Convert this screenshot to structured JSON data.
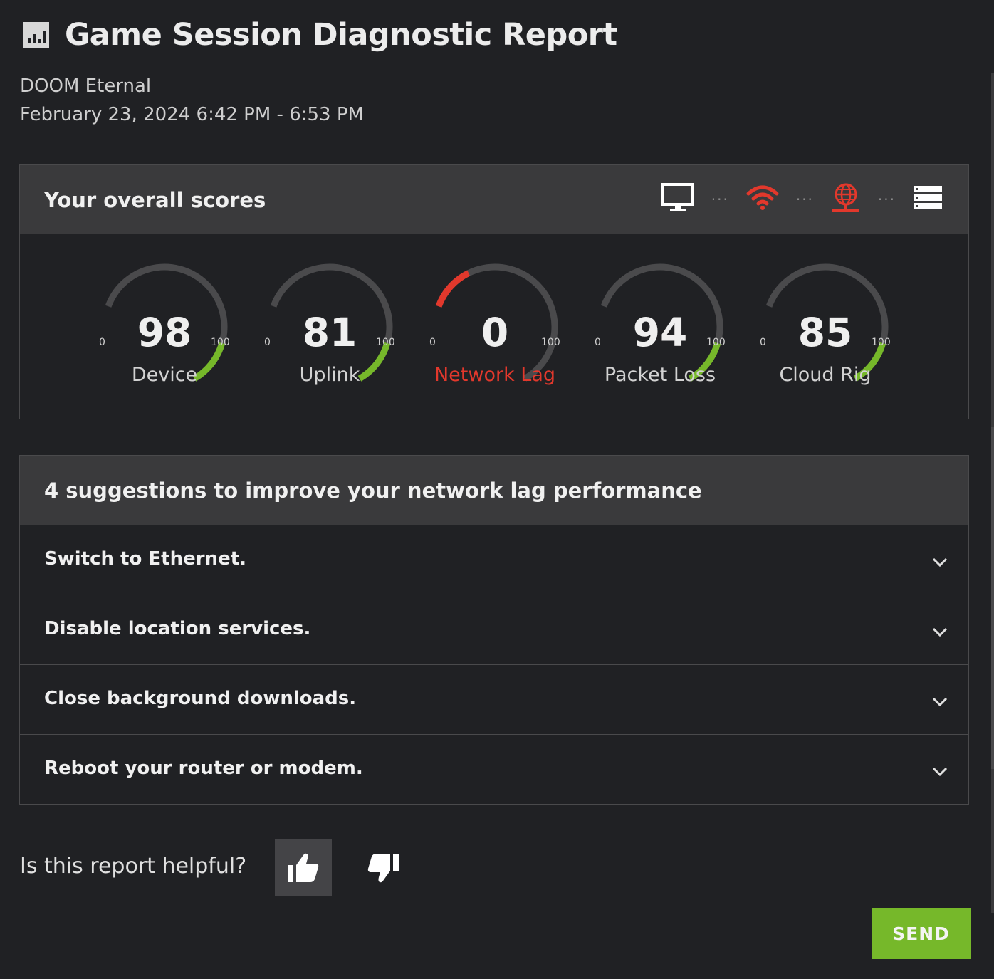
{
  "header": {
    "title": "Game Session Diagnostic Report",
    "game": "DOOM Eternal",
    "date_range": "February 23, 2024 6:42 PM - 6:53 PM"
  },
  "scores": {
    "title": "Your overall scores",
    "path_icons": [
      {
        "icon": "monitor-icon",
        "color": "#ffffff"
      },
      {
        "icon": "wifi-icon",
        "color": "#e2382c"
      },
      {
        "icon": "globe-icon",
        "color": "#e2382c"
      },
      {
        "icon": "server-icon",
        "color": "#ffffff"
      }
    ],
    "gauges": [
      {
        "label": "Device",
        "value": "98",
        "min": "0",
        "max": "100",
        "status": "good"
      },
      {
        "label": "Uplink",
        "value": "81",
        "min": "0",
        "max": "100",
        "status": "good"
      },
      {
        "label": "Network Lag",
        "value": "0",
        "min": "0",
        "max": "100",
        "status": "bad"
      },
      {
        "label": "Packet Loss",
        "value": "94",
        "min": "0",
        "max": "100",
        "status": "good"
      },
      {
        "label": "Cloud Rig",
        "value": "85",
        "min": "0",
        "max": "100",
        "status": "good"
      }
    ]
  },
  "suggestions": {
    "title": "4 suggestions to improve your network lag performance",
    "items": [
      "Switch to Ethernet.",
      "Disable location services.",
      "Close background downloads.",
      "Reboot your router or modem."
    ]
  },
  "feedback": {
    "question": "Is this report helpful?",
    "selected": "thumbs-up",
    "send_label": "SEND"
  },
  "colors": {
    "good": "#76b82a",
    "bad": "#e2382c",
    "track": "#4a4a4c",
    "accent": "#76b82a"
  }
}
